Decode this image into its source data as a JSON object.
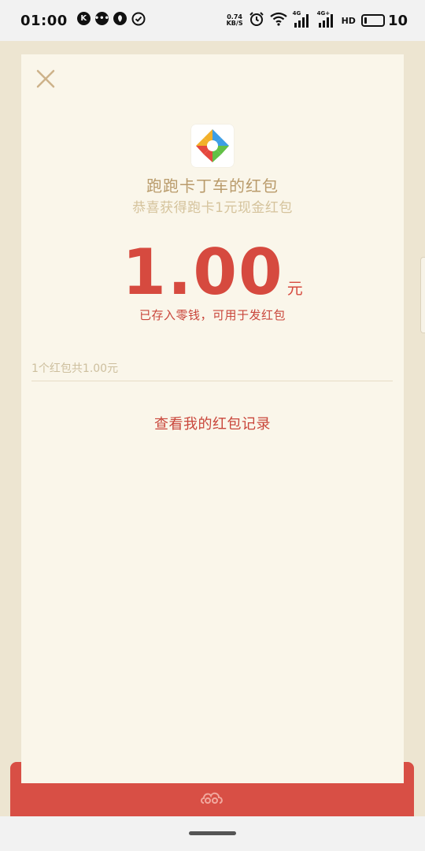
{
  "status_bar": {
    "time": "01:00",
    "speed_top": "0.74",
    "speed_bottom": "KB/S",
    "network_1": "4G",
    "network_2": "4G+",
    "hd": "HD",
    "battery_level": "10",
    "notification_icons": [
      "k-app-icon",
      "message-icon",
      "leaf-icon",
      "check-circle-icon"
    ],
    "status_icons": [
      "alarm-icon",
      "wifi-icon",
      "signal-icon",
      "signal-icon",
      "hd-icon",
      "battery-icon"
    ]
  },
  "card": {
    "title": "跑跑卡丁车的红包",
    "subtitle": "恭喜获得跑卡1元现金红包",
    "amount": "1.00",
    "unit": "元",
    "note": "已存入零钱，可用于发红包",
    "summary": "1个红包共1.00元",
    "records_link": "查看我的红包记录"
  },
  "colors": {
    "page_bg": "#ede5d1",
    "card_bg": "#faf6ea",
    "accent_red": "#d64a3f",
    "gold": "#b99b6b",
    "light_gold": "#d5c39c",
    "red_bottom": "#d84f45"
  }
}
